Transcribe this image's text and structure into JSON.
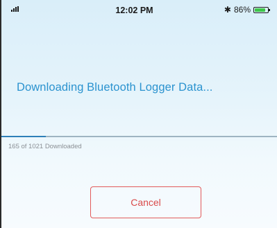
{
  "status_bar": {
    "time": "12:02 PM",
    "battery_text": "86%",
    "battery_level": 0.86,
    "bluetooth_icon": "bluetooth-icon",
    "signal_icon": "signal-bars-icon",
    "battery_icon": "battery-icon"
  },
  "main": {
    "title": "Downloading Bluetooth Logger Data...",
    "progress": {
      "downloaded": 165,
      "total": 1021,
      "fraction": 0.1616,
      "text": "165 of 1021 Downloaded"
    },
    "cancel_label": "Cancel"
  },
  "colors": {
    "title": "#2b93cf",
    "progress_fill": "#2f7fb8",
    "cancel": "#d94a4a",
    "battery_fill": "#3ec64a"
  }
}
